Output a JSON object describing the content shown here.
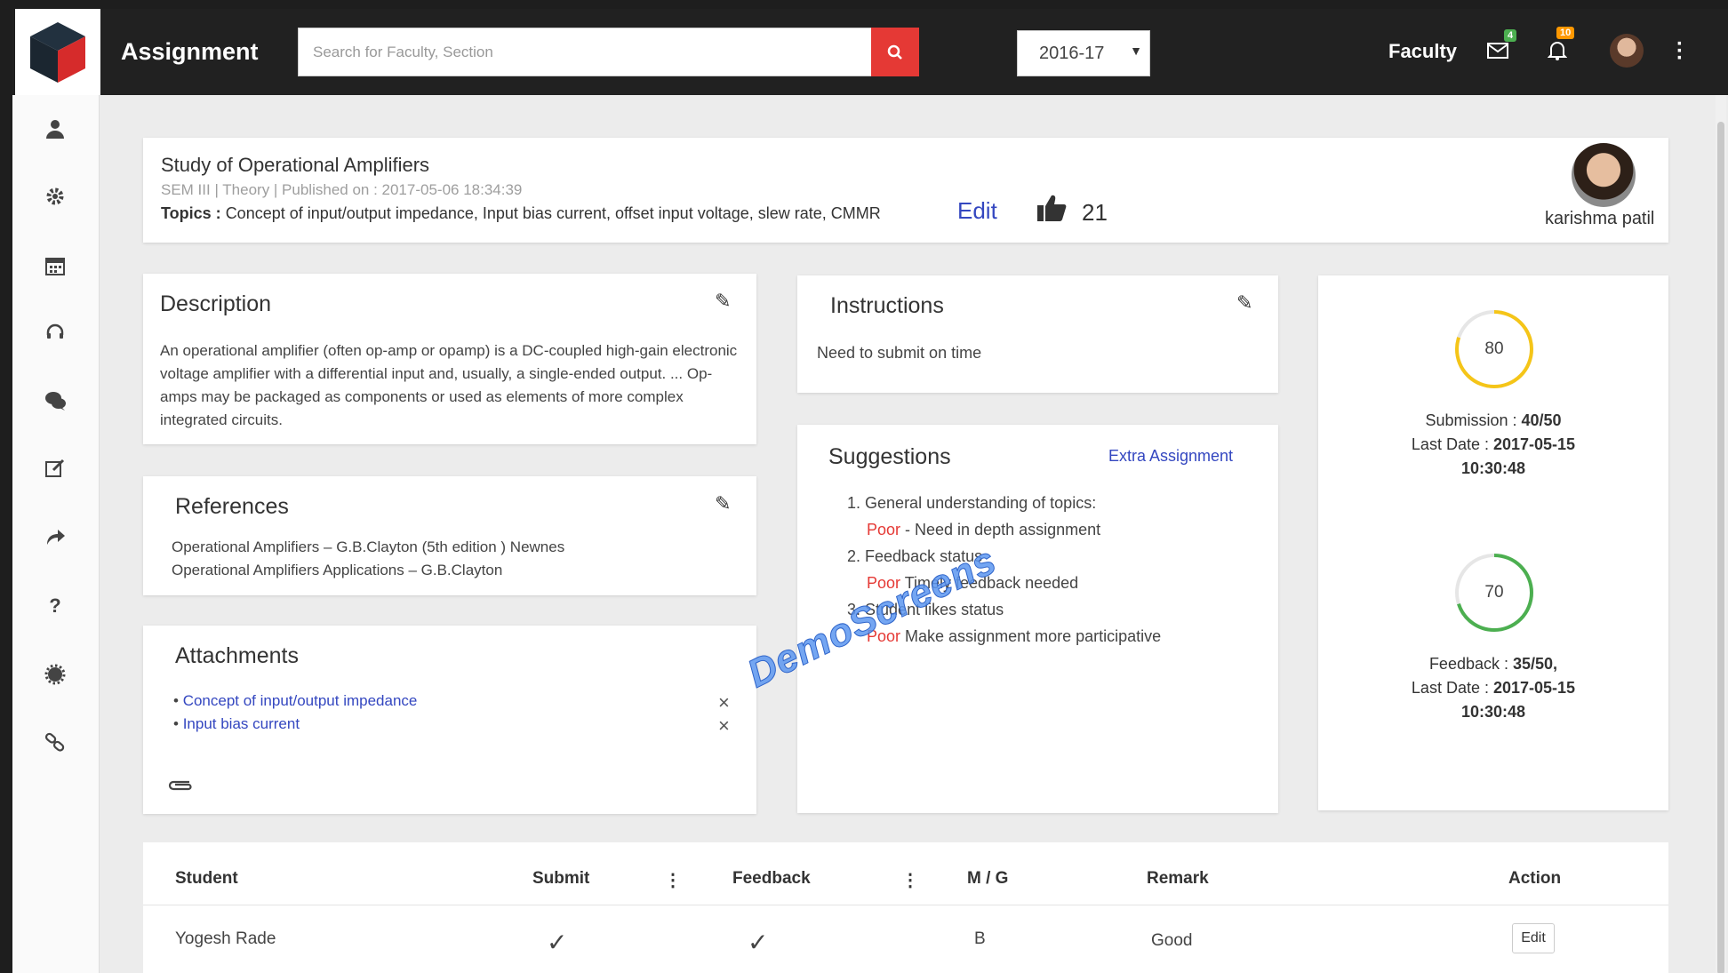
{
  "header": {
    "title": "Assignment",
    "search_placeholder": "Search for Faculty, Section",
    "year": "2016-17",
    "role": "Faculty",
    "mail_count": "4",
    "notif_count": "10",
    "colors": {
      "bar": "#212121",
      "search_button": "#e53935",
      "mail_badge": "#4caf50",
      "notif_badge": "#ff9800"
    }
  },
  "sidebar": {
    "items": [
      {
        "icon": "user-icon"
      },
      {
        "icon": "gear-icon"
      },
      {
        "icon": "calendar-icon"
      },
      {
        "icon": "headset-icon"
      },
      {
        "icon": "chat-icon"
      },
      {
        "icon": "edit-icon"
      },
      {
        "icon": "share-icon"
      },
      {
        "icon": "help-icon"
      },
      {
        "icon": "settings-cog-icon"
      },
      {
        "icon": "link-icon"
      }
    ]
  },
  "assignment": {
    "title": "Study of Operational Amplifiers",
    "meta": "SEM III | Theory | Published on : 2017-05-06 18:34:39",
    "topics_label": "Topics :",
    "topics": "Concept of input/output impedance, Input bias current, offset input voltage, slew rate, CMMR",
    "edit_label": "Edit",
    "likes": "21",
    "author": "karishma patil"
  },
  "description": {
    "title": "Description",
    "text": "An operational amplifier (often op-amp or opamp) is a DC-coupled high-gain electronic voltage amplifier with a differential input and, usually, a single-ended output. ... Op-amps may be packaged as components or used as elements of more complex integrated circuits."
  },
  "references": {
    "title": "References",
    "items": [
      "Operational Amplifiers – G.B.Clayton (5th edition ) Newnes",
      "Operational Amplifiers Applications – G.B.Clayton"
    ]
  },
  "attachments": {
    "title": "Attachments",
    "items": [
      "Concept of input/output impedance",
      "Input bias current"
    ]
  },
  "instructions": {
    "title": "Instructions",
    "text": "Need to submit on time"
  },
  "suggestions": {
    "title": "Suggestions",
    "extra_link": "Extra Assignment",
    "items": [
      {
        "num": "1.",
        "text": "General understanding of topics:",
        "rating": "Poor",
        "note": " - Need in depth assignment"
      },
      {
        "num": "2.",
        "text": "Feedback status",
        "rating": "Poor",
        "note": " Timely feedback needed"
      },
      {
        "num": "3.",
        "text": "Student likes status",
        "rating": "Poor",
        "note": " Make assignment more participative"
      }
    ]
  },
  "stats": {
    "submission": {
      "value": "80",
      "percent": 80,
      "label": "Submission : ",
      "count": "40/50",
      "date_label": "Last Date : ",
      "date": "2017-05-15",
      "time": "10:30:48",
      "color": "#f5c518"
    },
    "feedback": {
      "value": "70",
      "percent": 70,
      "label": "Feedback : ",
      "count": "35/50,",
      "date_label": "Last Date : ",
      "date": "2017-05-15",
      "time": "10:30:48",
      "color": "#4caf50"
    }
  },
  "table": {
    "headers": {
      "student": "Student",
      "submit": "Submit",
      "feedback": "Feedback",
      "mg": "M / G",
      "remark": "Remark",
      "action": "Action"
    },
    "rows": [
      {
        "student": "Yogesh Rade",
        "submit": "✓",
        "feedback": "✓",
        "mg": "B",
        "remark": "Good",
        "action": "Edit"
      }
    ]
  },
  "watermark": "DemoScreens"
}
